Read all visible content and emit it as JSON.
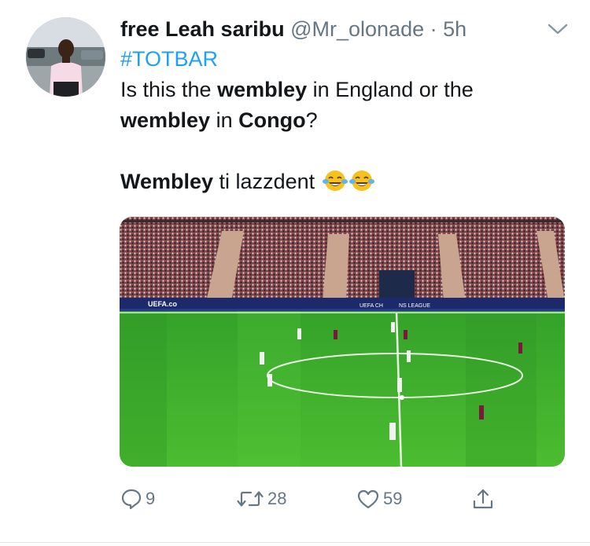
{
  "tweet": {
    "display_name": "free Leah saribu",
    "handle": "@Mr_olonade",
    "separator": "·",
    "time": "5h",
    "hashtag": "#TOTBAR",
    "line1": {
      "a": "Is this the ",
      "b": "wembley",
      "c": " in England or the"
    },
    "line2": {
      "a": "wembley",
      "b": " in ",
      "c": "Congo",
      "d": "?"
    },
    "line3": {
      "a": "Wembley",
      "b": " ti lazzdent"
    },
    "emojis": [
      "face-with-tears-of-joy",
      "face-with-tears-of-joy"
    ]
  },
  "media": {
    "boards": [
      "UEFA.co",
      "UEFA CH",
      "NS LEAGUE"
    ]
  },
  "actions": {
    "reply_count": "9",
    "retweet_count": "28",
    "like_count": "59"
  },
  "icons": {
    "chevron": "chevron-down-icon",
    "reply": "reply-icon",
    "retweet": "retweet-icon",
    "like": "heart-icon",
    "share": "share-icon"
  },
  "colors": {
    "link": "#1da1f2",
    "secondary_text": "#657786",
    "pitch": "#3fae2a"
  }
}
